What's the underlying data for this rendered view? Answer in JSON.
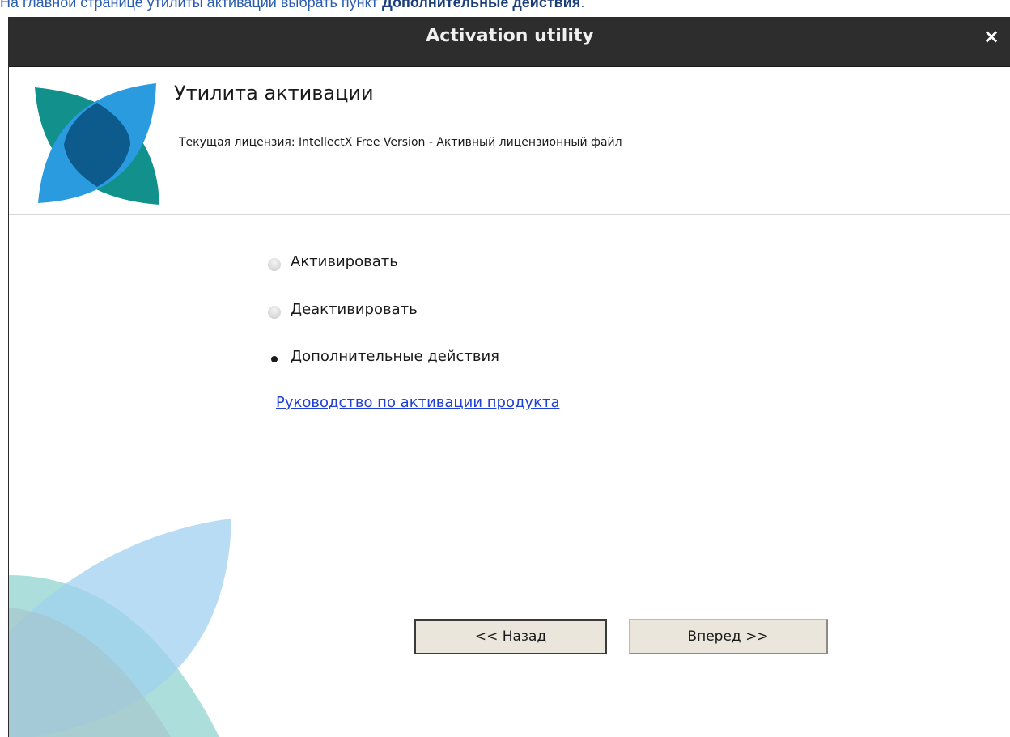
{
  "caption": {
    "prefix": "На главной странице утилиты активации выбрать пункт ",
    "bold": "Дополнительные действия",
    "suffix": "."
  },
  "window": {
    "title": "Activation utility",
    "close_glyph": "×"
  },
  "header": {
    "app_title": "Утилита активации",
    "license_text": "Текущая лицензия: IntellectX Free Version - Активный лицензионный файл"
  },
  "options": [
    {
      "label": "Активировать",
      "checked": false
    },
    {
      "label": "Деактивировать",
      "checked": false
    },
    {
      "label": "Дополнительные действия",
      "checked": true
    }
  ],
  "guide_link": "Руководство по активации продукта",
  "buttons": {
    "back": "<< Назад",
    "next": "Вперед >>"
  },
  "colors": {
    "logo_teal": "#12918c",
    "logo_blue": "#2b9be0",
    "logo_dark": "#0d5a8c",
    "link": "#1f3fd6"
  },
  "icons": {
    "logo": "activation-logo-icon",
    "close": "close-icon"
  }
}
